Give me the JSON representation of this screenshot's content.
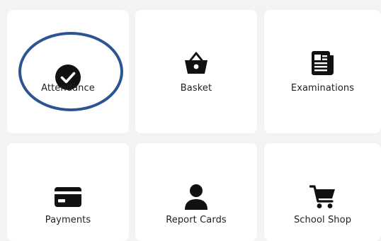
{
  "tiles": [
    {
      "label": "Attendance",
      "icon": "check-circle-icon"
    },
    {
      "label": "Basket",
      "icon": "basket-icon"
    },
    {
      "label": "Examinations",
      "icon": "newspaper-icon"
    },
    {
      "label": "Payments",
      "icon": "credit-card-icon"
    },
    {
      "label": "Report Cards",
      "icon": "person-icon"
    },
    {
      "label": "School Shop",
      "icon": "shopping-cart-icon"
    }
  ],
  "colors": {
    "background": "#f3f3f3",
    "tile": "#ffffff",
    "icon": "#111111",
    "highlight_ring": "#2b5592"
  }
}
